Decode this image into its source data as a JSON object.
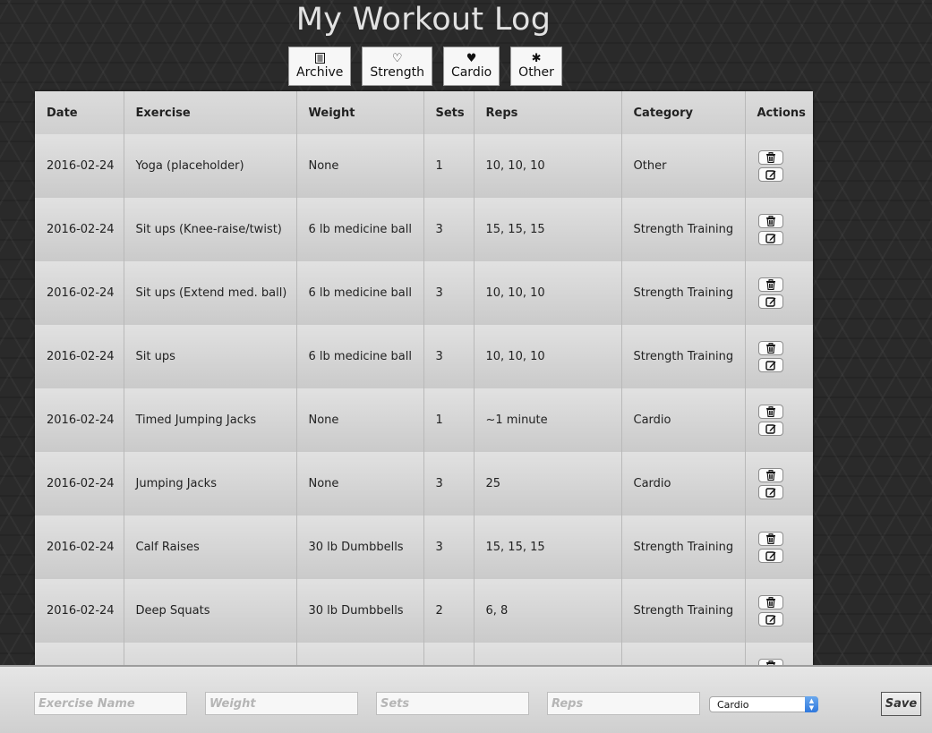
{
  "page": {
    "title": "My Workout Log"
  },
  "nav": [
    {
      "label": "Archive",
      "icon": "list-icon"
    },
    {
      "label": "Strength",
      "icon": "heart-outline-icon"
    },
    {
      "label": "Cardio",
      "icon": "heart-filled-icon"
    },
    {
      "label": "Other",
      "icon": "asterisk-icon"
    }
  ],
  "table": {
    "headers": [
      "Date",
      "Exercise",
      "Weight",
      "Sets",
      "Reps",
      "Category",
      "Actions"
    ],
    "rows": [
      {
        "date": "2016-02-24",
        "exercise": "Yoga (placeholder)",
        "weight": "None",
        "sets": "1",
        "reps": "10, 10, 10",
        "category": "Other"
      },
      {
        "date": "2016-02-24",
        "exercise": "Sit ups (Knee-raise/twist)",
        "weight": "6 lb medicine ball",
        "sets": "3",
        "reps": "15, 15, 15",
        "category": "Strength Training"
      },
      {
        "date": "2016-02-24",
        "exercise": "Sit ups (Extend med. ball)",
        "weight": "6 lb medicine ball",
        "sets": "3",
        "reps": "10, 10, 10",
        "category": "Strength Training"
      },
      {
        "date": "2016-02-24",
        "exercise": "Sit ups",
        "weight": "6 lb medicine ball",
        "sets": "3",
        "reps": "10, 10, 10",
        "category": "Strength Training"
      },
      {
        "date": "2016-02-24",
        "exercise": "Timed Jumping Jacks",
        "weight": "None",
        "sets": "1",
        "reps": "~1 minute",
        "category": "Cardio"
      },
      {
        "date": "2016-02-24",
        "exercise": "Jumping Jacks",
        "weight": "None",
        "sets": "3",
        "reps": "25",
        "category": "Cardio"
      },
      {
        "date": "2016-02-24",
        "exercise": "Calf Raises",
        "weight": "30 lb Dumbbells",
        "sets": "3",
        "reps": "15, 15, 15",
        "category": "Strength Training"
      },
      {
        "date": "2016-02-24",
        "exercise": "Deep Squats",
        "weight": "30 lb Dumbbells",
        "sets": "2",
        "reps": "6, 8",
        "category": "Strength Training"
      },
      {
        "date": "",
        "exercise": "",
        "weight": "",
        "sets": "",
        "reps": "",
        "category": ""
      }
    ],
    "action_icons": [
      "trash-icon",
      "edit-icon"
    ]
  },
  "form": {
    "exercise_placeholder": "Exercise Name",
    "weight_placeholder": "Weight",
    "sets_placeholder": "Sets",
    "reps_placeholder": "Reps",
    "category_selected": "Cardio",
    "save_label": "Save"
  },
  "colors": {
    "background": "#2a2a2a",
    "title": "#e2e2e2",
    "select_accent": "#2f78dd"
  }
}
